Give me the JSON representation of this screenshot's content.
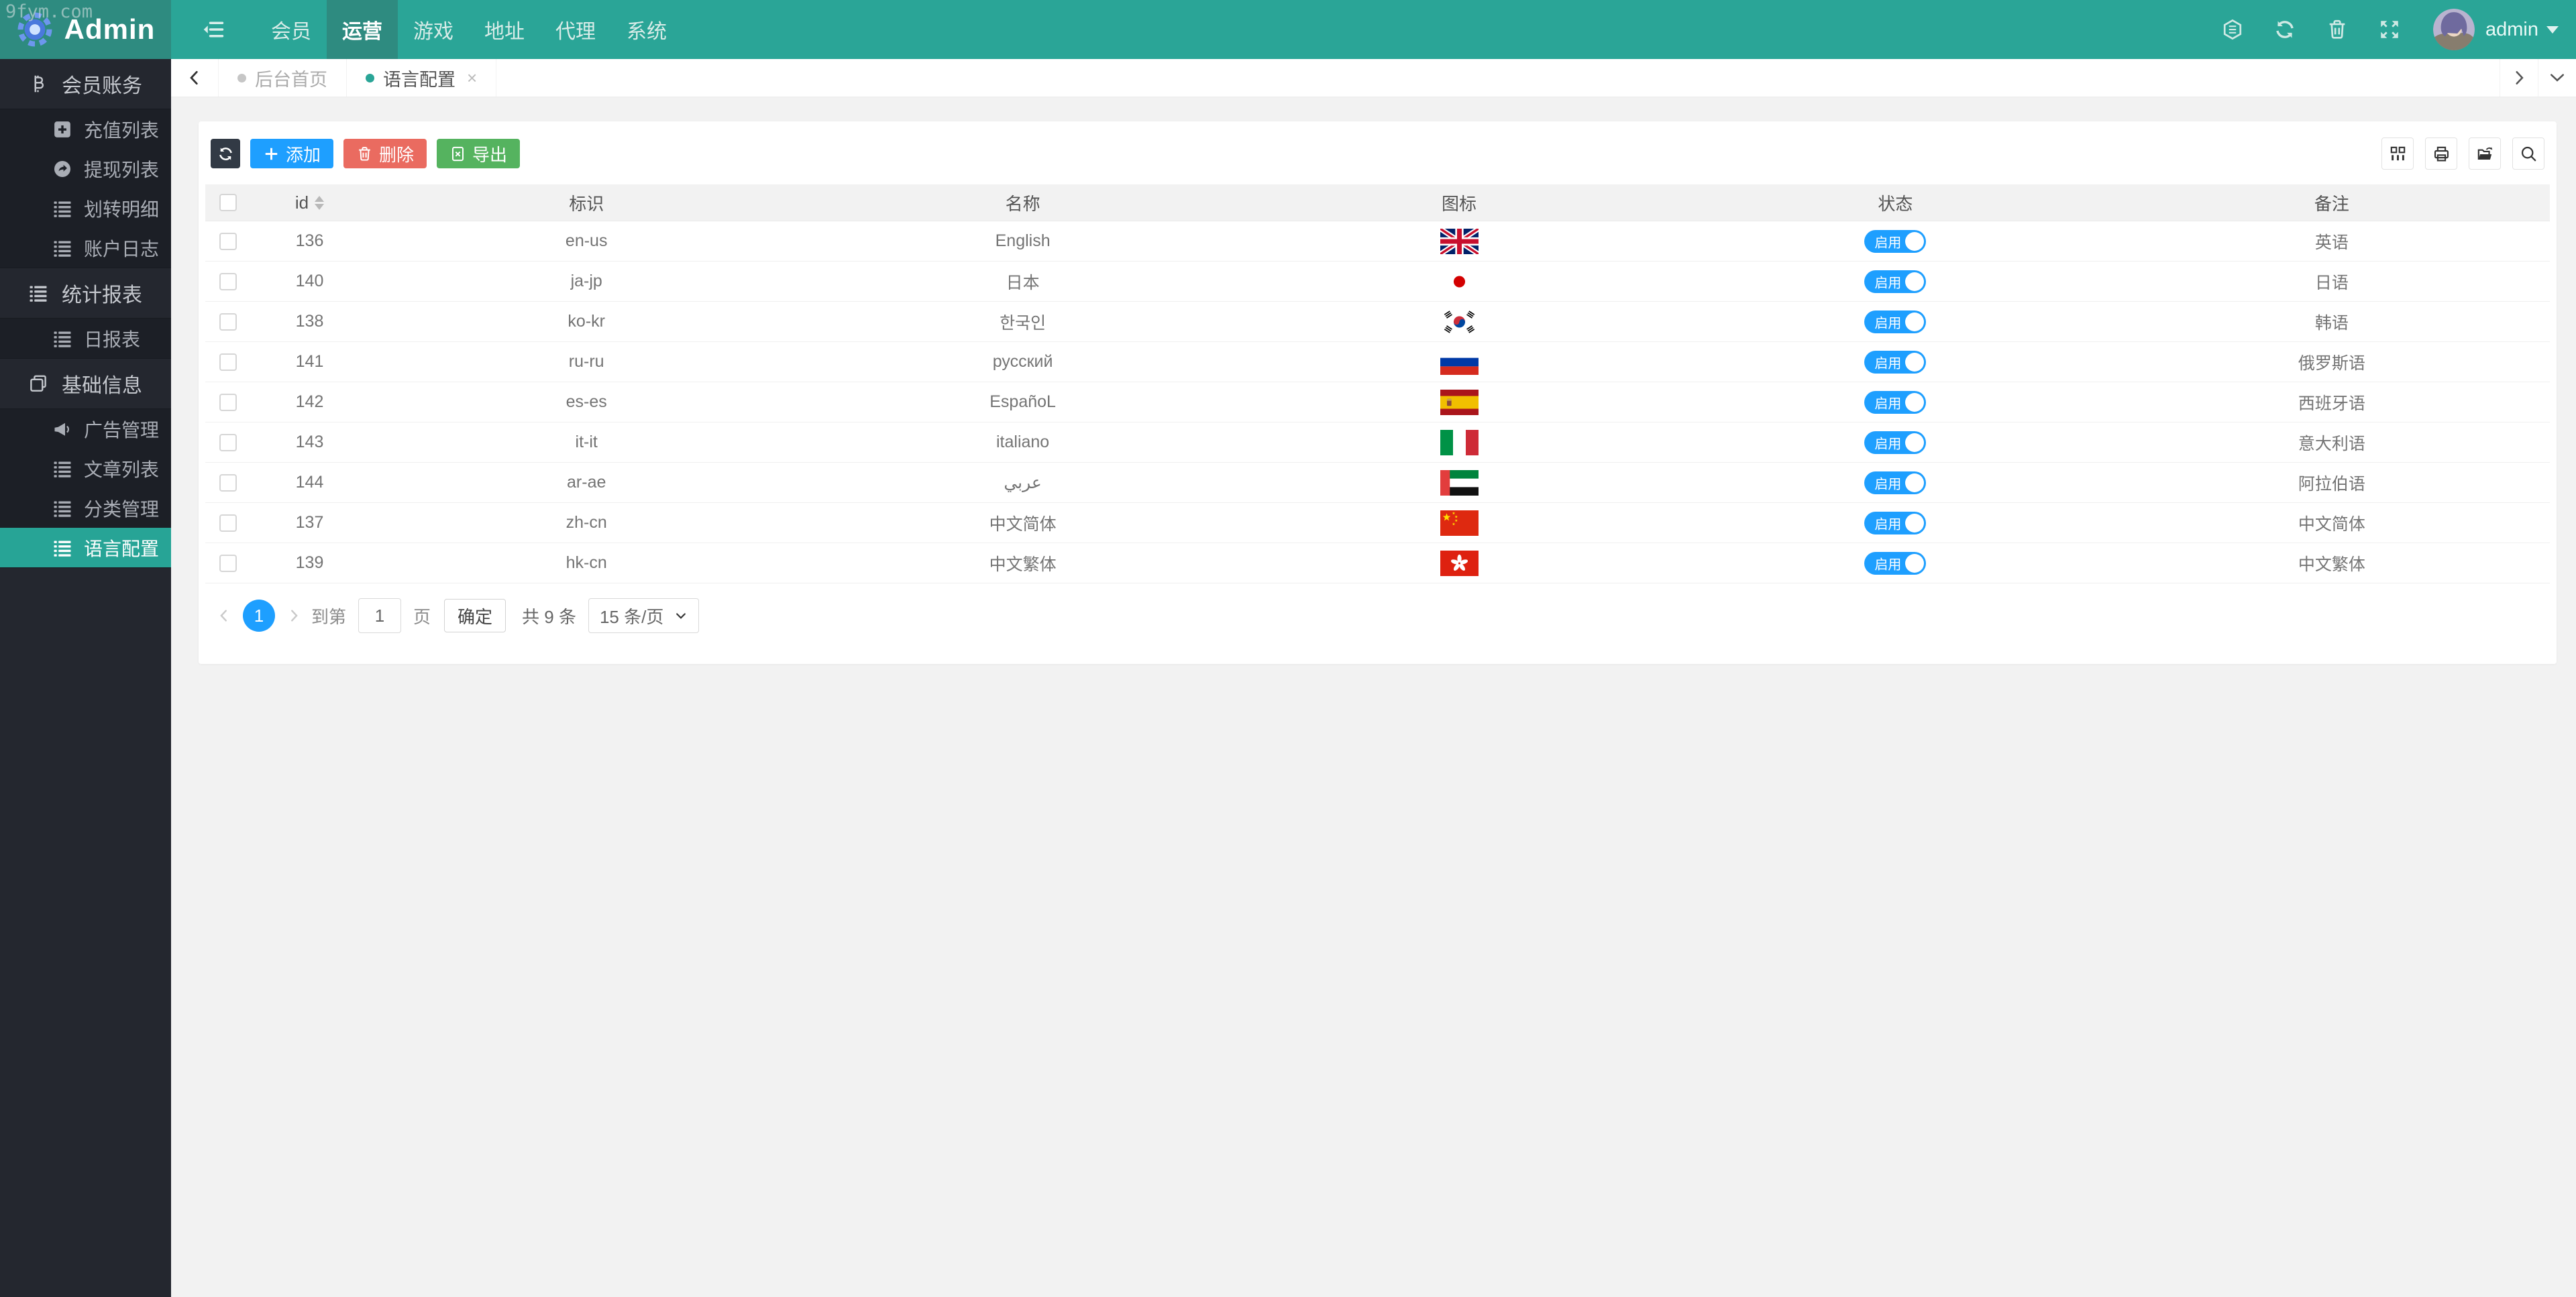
{
  "watermark": "9fym.com",
  "colors": {
    "header_teal": "#2aa597",
    "header_teal_dark": "#2e8b80",
    "sidebar_dark": "#24272f",
    "accent_blue": "#1e9fff",
    "danger_red": "#ea6b60",
    "success_green": "#55b35f",
    "toggle_blue": "#1e9fff"
  },
  "header": {
    "brand": "Admin",
    "nav": [
      {
        "label": "会员",
        "active": false
      },
      {
        "label": "运营",
        "active": true
      },
      {
        "label": "游戏",
        "active": false
      },
      {
        "label": "地址",
        "active": false
      },
      {
        "label": "代理",
        "active": false
      },
      {
        "label": "系统",
        "active": false
      }
    ],
    "action_icons": [
      "honeycomb",
      "refresh",
      "trash",
      "fullscreen"
    ],
    "username": "admin"
  },
  "tabbar": {
    "tabs": [
      {
        "label": "后台首页",
        "active": false,
        "closable": false
      },
      {
        "label": "语言配置",
        "active": true,
        "closable": true
      }
    ]
  },
  "sidebar": {
    "groups": [
      {
        "label": "会员账务",
        "icon": "bitcoin-icon",
        "items": [
          {
            "label": "充值列表",
            "icon": "plus-square-icon",
            "active": false
          },
          {
            "label": "提现列表",
            "icon": "share-icon",
            "active": false
          },
          {
            "label": "划转明细",
            "icon": "list-icon",
            "active": false
          },
          {
            "label": "账户日志",
            "icon": "list-icon",
            "active": false
          }
        ]
      },
      {
        "label": "统计报表",
        "icon": "list-icon",
        "items": [
          {
            "label": "日报表",
            "icon": "list-icon",
            "active": false
          }
        ]
      },
      {
        "label": "基础信息",
        "icon": "copy-icon",
        "items": [
          {
            "label": "广告管理",
            "icon": "megaphone-icon",
            "active": false
          },
          {
            "label": "文章列表",
            "icon": "list-icon",
            "active": false
          },
          {
            "label": "分类管理",
            "icon": "list-icon",
            "active": false
          },
          {
            "label": "语言配置",
            "icon": "list-icon",
            "active": true
          }
        ]
      }
    ]
  },
  "toolbar": {
    "buttons": [
      {
        "name": "refresh-button",
        "icon": "refresh",
        "label": "",
        "style": "dark"
      },
      {
        "name": "add-button",
        "icon": "plus",
        "label": "添加",
        "style": "blue"
      },
      {
        "name": "delete-button",
        "icon": "trash",
        "label": "删除",
        "style": "red"
      },
      {
        "name": "export-button",
        "icon": "file",
        "label": "导出",
        "style": "green"
      }
    ],
    "tools": [
      "filter-columns",
      "print",
      "export",
      "search"
    ]
  },
  "table": {
    "columns": [
      "id",
      "标识",
      "名称",
      "图标",
      "状态",
      "备注"
    ],
    "status_on_label": "启用",
    "rows": [
      {
        "id": "136",
        "code": "en-us",
        "name": "English",
        "flag": "gb",
        "status_on": true,
        "remark": "英语"
      },
      {
        "id": "140",
        "code": "ja-jp",
        "name": "日本",
        "flag": "jp",
        "status_on": true,
        "remark": "日语"
      },
      {
        "id": "138",
        "code": "ko-kr",
        "name": "한국인",
        "flag": "kr",
        "status_on": true,
        "remark": "韩语"
      },
      {
        "id": "141",
        "code": "ru-ru",
        "name": "русский",
        "flag": "ru",
        "status_on": true,
        "remark": "俄罗斯语"
      },
      {
        "id": "142",
        "code": "es-es",
        "name": "EspañoL",
        "flag": "es",
        "status_on": true,
        "remark": "西班牙语"
      },
      {
        "id": "143",
        "code": "it-it",
        "name": "italiano",
        "flag": "it",
        "status_on": true,
        "remark": "意大利语"
      },
      {
        "id": "144",
        "code": "ar-ae",
        "name": "عربي",
        "flag": "ae",
        "status_on": true,
        "remark": "阿拉伯语"
      },
      {
        "id": "137",
        "code": "zh-cn",
        "name": "中文简体",
        "flag": "cn",
        "status_on": true,
        "remark": "中文简体"
      },
      {
        "id": "139",
        "code": "hk-cn",
        "name": "中文繁体",
        "flag": "hk",
        "status_on": true,
        "remark": "中文繁体"
      }
    ]
  },
  "pagination": {
    "current_page": "1",
    "goto_prefix": "到第",
    "goto_value": "1",
    "goto_suffix": "页",
    "confirm_label": "确定",
    "total": "共 9 条",
    "page_size": "15 条/页"
  }
}
